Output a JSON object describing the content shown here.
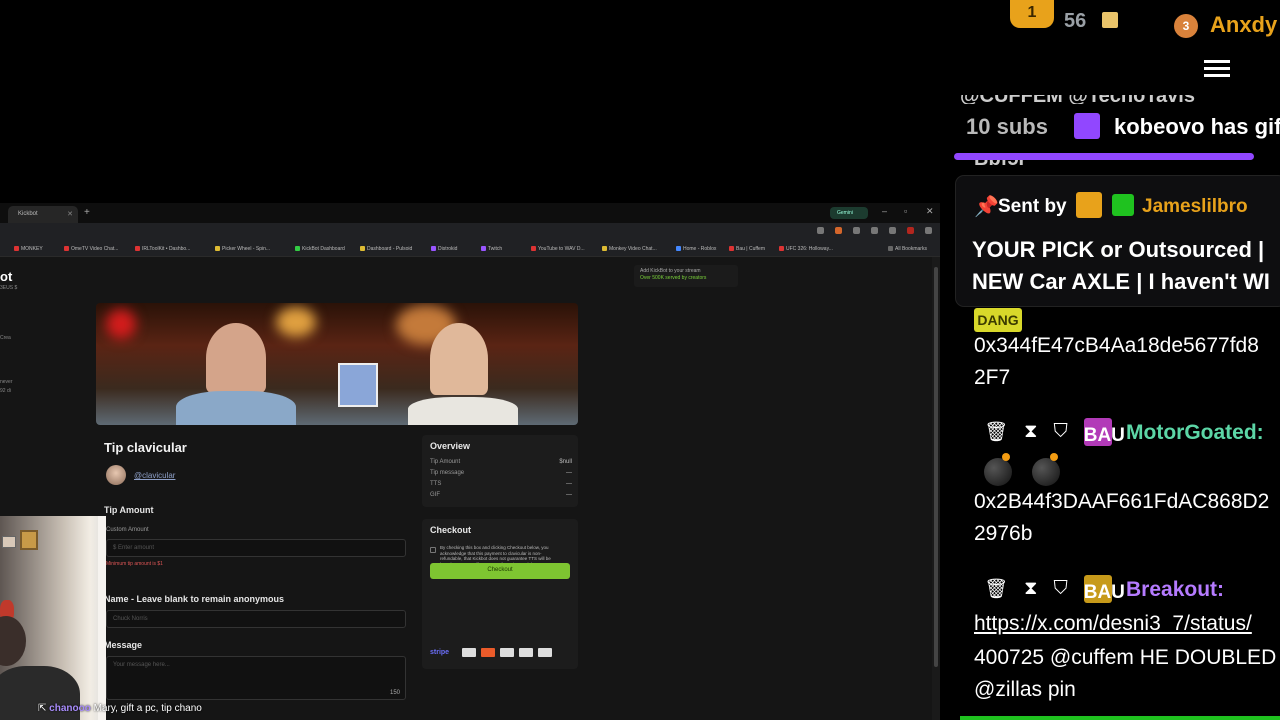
{
  "browser": {
    "tab_title": "Kickbot",
    "gemini_label": "Gemini",
    "bookmarks": [
      {
        "label": "MONKEY",
        "color": "red"
      },
      {
        "label": "OmeTV Video Chat...",
        "color": "red"
      },
      {
        "label": "IRLToolKit • Dashbo...",
        "color": "red"
      },
      {
        "label": "Picker Wheel - Spin...",
        "color": "yellow"
      },
      {
        "label": "KickBot Dashboard",
        "color": "green"
      },
      {
        "label": "Dashboard - Pulsoid",
        "color": "yellow"
      },
      {
        "label": "Distrokid",
        "color": "purple"
      },
      {
        "label": "Twitch",
        "color": "purple"
      },
      {
        "label": "YouTube to WAV D...",
        "color": "red"
      },
      {
        "label": "Monkey Video Chat...",
        "color": "yellow"
      },
      {
        "label": "Home - Roblox",
        "color": "blue"
      },
      {
        "label": "Bau | Cuffem",
        "color": "red"
      },
      {
        "label": "UFC 326: Holloway...",
        "color": "red"
      },
      {
        "label": "All Bookmarks",
        "color": "gray"
      }
    ]
  },
  "page": {
    "nav_logo": "ot",
    "nav_sub": "3EUS $",
    "nav_items": [
      "Crea",
      "never",
      "92 di"
    ],
    "ad": {
      "title": "Add KickBot to your stream",
      "line": "Over 500K served by creators"
    },
    "tip_title": "Tip clavicular",
    "tip_handle": "@clavicular",
    "tip_amount_label": "Tip Amount",
    "custom_amount_label": "Custom Amount",
    "amount_placeholder": "$  Enter amount",
    "amount_error": "Minimum tip amount is $1",
    "name_label": "Name - Leave blank to remain anonymous",
    "name_placeholder": "Chuck Norris",
    "message_label": "Message",
    "message_placeholder": "Your message here...",
    "message_counter": "150",
    "overview": {
      "title": "Overview",
      "rows": [
        {
          "label": "Tip Amount",
          "value": "$null"
        },
        {
          "label": "Tip message",
          "value": "—"
        },
        {
          "label": "TTS",
          "value": "—"
        },
        {
          "label": "GIF",
          "value": "—"
        }
      ]
    },
    "checkout": {
      "title": "Checkout",
      "text": "By checking this box and clicking Checkout below, you acknowledge that this payment to clavicular is non-refundable, that Kickbot does not guarantee TTS will be heard or any specific outcome from tips, and that streamers have full discretion over tips. You also agree to our terms of service and refund policy.",
      "button": "Checkout",
      "payment_brand": "stripe"
    }
  },
  "stream_chat": {
    "user": "chanooo",
    "message": "Mary, gift a pc, tip chano"
  },
  "chat": {
    "leaderboard": [
      {
        "rank": "1",
        "count": "56"
      },
      {
        "rank": "3",
        "name": "Anxdy"
      }
    ],
    "cut_top": "@CUFFEM @TechoTavis",
    "sub_banner": {
      "count": "10 subs",
      "text": "kobeovo has gift"
    },
    "cut_line": "Bbf5F",
    "pinned": {
      "sent_by": "Sent by",
      "badge": "BAU",
      "user": "Jameslilbro",
      "line1": "YOUR PICK or Outsourced |",
      "line2": "NEW Car AXLE | I haven't WI"
    },
    "messages": [
      {
        "badge": "DANG",
        "text1": "0x344fE47cB4Aa18de5677fd8",
        "text2": "2F7"
      },
      {
        "badge": "BAU",
        "user": "MotorGoated:",
        "user_color": "#5cd6a6",
        "text1": "0x2B44f3DAAF661FdAC868D2",
        "text2": "2976b"
      },
      {
        "badge": "BAU",
        "user": "Breakout:",
        "user_color": "#b57bff",
        "link1": "https://x.com/desni3_7/status/",
        "text2": "400725 @cuffem HE DOUBLED",
        "text3": "@zillas pin"
      }
    ]
  }
}
